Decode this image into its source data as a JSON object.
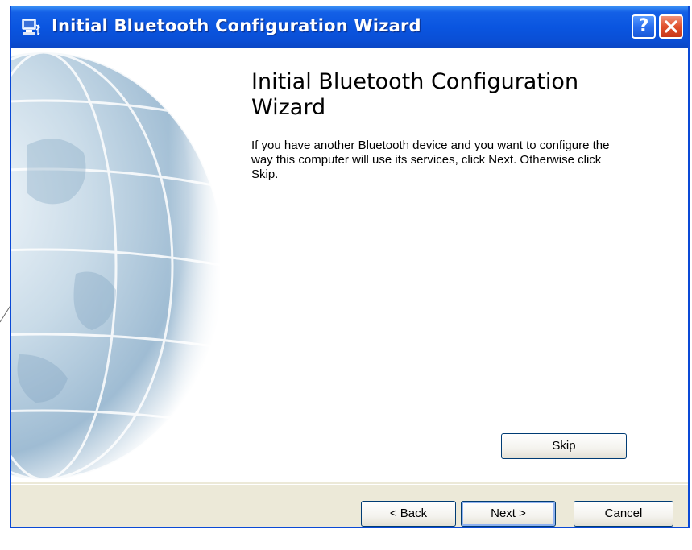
{
  "window": {
    "title": "Initial Bluetooth Configuration Wizard",
    "help_glyph": "?",
    "close_glyph": "X",
    "icon": "bluetooth-computer-icon"
  },
  "content": {
    "heading": "Initial Bluetooth Configuration Wizard",
    "description": "If you have another Bluetooth device and you want to configure the way this computer will use its services, click Next. Otherwise click Skip.",
    "skip_label": "Skip"
  },
  "footer": {
    "back_label": "< Back",
    "next_label": "Next >",
    "cancel_label": "Cancel"
  },
  "colors": {
    "titlebar": "#0a55e0",
    "dialog_bg": "#ece9d8",
    "content_bg": "#ffffff",
    "button_border": "#003c74"
  }
}
